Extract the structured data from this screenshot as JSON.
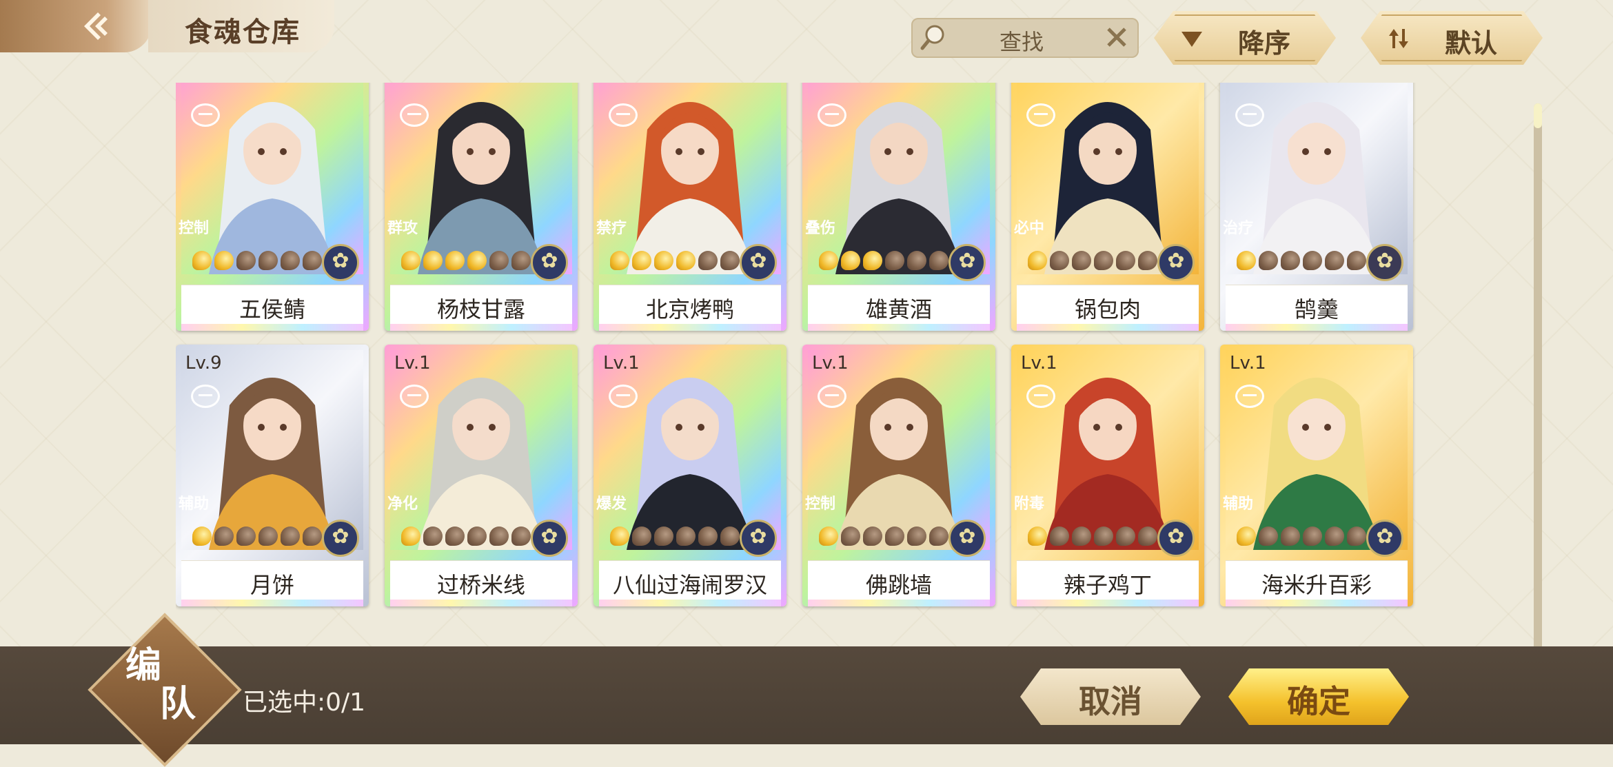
{
  "header": {
    "title": "食魂仓库",
    "search": {
      "text": "查找"
    },
    "sort_order": "降序",
    "sort_mode": "默认"
  },
  "cards": [
    {
      "name": "五侯鲭",
      "level": "",
      "role": "控制",
      "stars": 2,
      "theme": "rainbow",
      "hair": "#e8edf2",
      "skin": "#f6dcc9",
      "outfit": "#9fb7de",
      "element_color": "#2f3a66"
    },
    {
      "name": "杨枝甘露",
      "level": "",
      "role": "群攻",
      "stars": 4,
      "theme": "rainbow",
      "hair": "#2a2a30",
      "skin": "#f4d6c2",
      "outfit": "#7d9ab0",
      "element_color": "#2f3a66"
    },
    {
      "name": "北京烤鸭",
      "level": "",
      "role": "禁疗",
      "stars": 4,
      "theme": "rainbow",
      "hair": "#d2592a",
      "skin": "#f6dac6",
      "outfit": "#f2efe7",
      "element_color": "#2f3a66"
    },
    {
      "name": "雄黄酒",
      "level": "",
      "role": "叠伤",
      "stars": 3,
      "theme": "rainbow",
      "hair": "#d9d9de",
      "skin": "#f3d7c3",
      "outfit": "#2b2b33",
      "element_color": "#2f3a66"
    },
    {
      "name": "锅包肉",
      "level": "",
      "role": "必中",
      "stars": 1,
      "theme": "gold",
      "hair": "#1d2438",
      "skin": "#f4d9c3",
      "outfit": "#efe2c0",
      "element_color": "#2f3a66"
    },
    {
      "name": "鹄羹",
      "level": "",
      "role": "治疗",
      "stars": 1,
      "theme": "silver",
      "hair": "#e9e6ee",
      "skin": "#f7e0d0",
      "outfit": "#f2f1f3",
      "element_color": "#3b3a55"
    },
    {
      "name": "月饼",
      "level": "Lv.9",
      "role": "辅助",
      "stars": 1,
      "theme": "silver",
      "hair": "#7d5a40",
      "skin": "#f6dac6",
      "outfit": "#e7a73b",
      "element_color": "#2f3a66"
    },
    {
      "name": "过桥米线",
      "level": "Lv.1",
      "role": "净化",
      "stars": 1,
      "theme": "rainbow",
      "hair": "#cfcfc8",
      "skin": "#f4dccb",
      "outfit": "#f4ecd8",
      "element_color": "#2f3a66"
    },
    {
      "name": "八仙过海闹罗汉",
      "level": "Lv.1",
      "role": "爆发",
      "stars": 1,
      "theme": "rainbow",
      "hair": "#c9cdf0",
      "skin": "#f4dcca",
      "outfit": "#22252e",
      "element_color": "#2f3a66"
    },
    {
      "name": "佛跳墙",
      "level": "Lv.1",
      "role": "控制",
      "stars": 1,
      "theme": "rainbow",
      "hair": "#8a5e3a",
      "skin": "#f4d9c4",
      "outfit": "#e9d9b0",
      "element_color": "#2f3a66"
    },
    {
      "name": "辣子鸡丁",
      "level": "Lv.1",
      "role": "附毒",
      "stars": 1,
      "theme": "gold",
      "hair": "#c8442a",
      "skin": "#f6d7c2",
      "outfit": "#a32a22",
      "element_color": "#2f3a66"
    },
    {
      "name": "海米升百彩",
      "level": "Lv.1",
      "role": "辅助",
      "stars": 1,
      "theme": "gold",
      "hair": "#f1dc82",
      "skin": "#f8e2d2",
      "outfit": "#2e7a45",
      "element_color": "#2f3a66"
    }
  ],
  "footer": {
    "team_label_1": "编",
    "team_label_2": "队",
    "selected_text": "已选中:0/1",
    "cancel_label": "取消",
    "confirm_label": "确定"
  }
}
